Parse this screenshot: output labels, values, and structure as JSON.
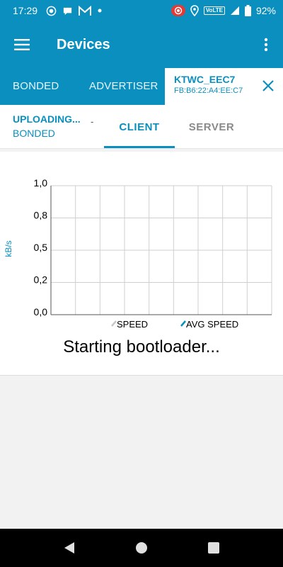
{
  "status_bar": {
    "time": "17:29",
    "battery_percent": "92%",
    "volte": "VoLTE",
    "icons_left": [
      "record-icon",
      "chat-icon",
      "gmail-icon",
      "dot-icon"
    ],
    "icons_right": [
      "screen-record-icon",
      "location-icon",
      "volte-icon",
      "signal-icon",
      "battery-icon"
    ]
  },
  "app_bar": {
    "title": "Devices",
    "menu_icon": "hamburger-menu-icon",
    "more_icon": "more-vert-icon"
  },
  "top_tabs": {
    "bonded": "BONDED",
    "advertiser": "ADVERTISER",
    "device_name": "KTWC_EEC7",
    "device_mac": "FB:B6:22:A4:EE:C7",
    "close_icon": "close-icon"
  },
  "connection": {
    "state": "UPLOADING...",
    "bond": "BONDED",
    "separator": "-"
  },
  "sub_tabs": {
    "client": "CLIENT",
    "server": "SERVER"
  },
  "chart_data": {
    "type": "line",
    "ylabel": "kB/s",
    "xlabel": "",
    "ylim": [
      0.0,
      1.0
    ],
    "y_ticks": [
      "1,0",
      "0,8",
      "0,5",
      "0,2",
      "0,0"
    ],
    "grid": true,
    "legend_position": "bottom",
    "series": [
      {
        "name": "SPEED",
        "values": [],
        "color": "#c8c8c8"
      },
      {
        "name": "AVG SPEED",
        "values": [],
        "color": "#0a8fbf"
      }
    ]
  },
  "status_message": "Starting bootloader...",
  "nav_bar": {
    "back_icon": "back-triangle-icon",
    "home_icon": "home-circle-icon",
    "recents_icon": "recents-square-icon"
  },
  "colors": {
    "primary": "#0a8fbf",
    "background": "#f2f2f2",
    "card": "#ffffff"
  }
}
